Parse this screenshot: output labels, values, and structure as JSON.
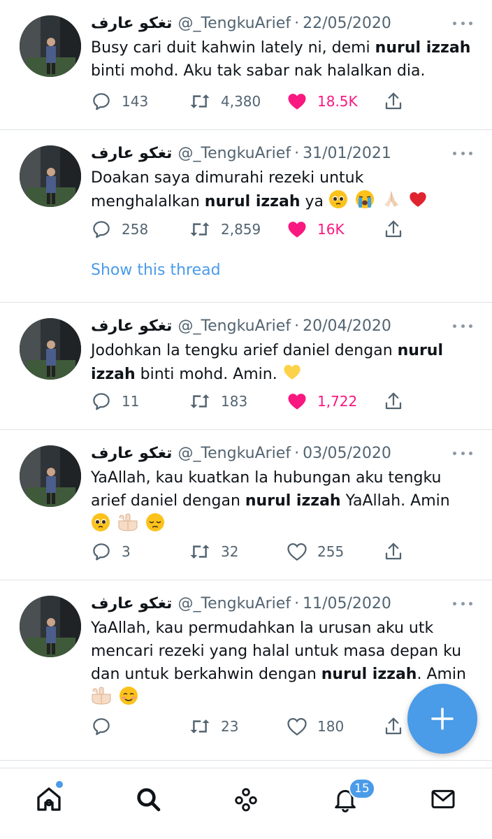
{
  "author": {
    "name": "تغكو عارف",
    "handle": "@_TengkuArief",
    "separator": "·"
  },
  "tweets": [
    {
      "date": "22/05/2020",
      "lines": [
        "Busy cari duit kahwin lately ni, demi ",
        "nurul izzah",
        "binti mohd. Aku tak sabar nak halalkan dia."
      ],
      "replies": "143",
      "retweets": "4,380",
      "likes": "18.5K",
      "liked": true
    },
    {
      "date": "31/01/2021",
      "lines": [
        "Doakan saya dimurahi rezeki untuk",
        "menghalalkan ",
        "nurul izzah",
        " ya"
      ],
      "emojis": [
        "pleading-face",
        "loudly-crying-face",
        "folded-hands",
        "red-heart"
      ],
      "replies": "258",
      "retweets": "2,859",
      "likes": "16K",
      "liked": true,
      "show_thread": "Show this thread"
    },
    {
      "date": "20/04/2020",
      "lines": [
        "Jodohkan la tengku arief daniel dengan ",
        "nurul",
        "izzah",
        " binti mohd. Amin."
      ],
      "emojis": [
        "yellow-heart"
      ],
      "replies": "11",
      "retweets": "183",
      "likes": "1,722",
      "liked": true
    },
    {
      "date": "03/05/2020",
      "lines": [
        "YaAllah, kau kuatkan la hubungan aku tengku",
        "arief daniel dengan ",
        "nurul izzah",
        " YaAllah. Amin"
      ],
      "emojis": [
        "pleading-face",
        "palms-up",
        "pensive-face"
      ],
      "replies": "3",
      "retweets": "32",
      "likes": "255",
      "liked": false
    },
    {
      "date": "11/05/2020",
      "lines": [
        "YaAllah, kau permudahkan la urusan aku utk",
        "mencari rezeki yang halal untuk masa depan ku",
        "dan untuk berkahwin dengan ",
        "nurul izzah",
        ". Amin"
      ],
      "emojis": [
        "palms-up",
        "smiling-face"
      ],
      "replies": "",
      "retweets": "23",
      "likes": "180",
      "liked": false
    }
  ],
  "nav": {
    "items": [
      "home-icon",
      "search-icon",
      "spaces-icon",
      "notifications-icon",
      "messages-icon"
    ],
    "notification_count": "15"
  },
  "colors": {
    "accent": "#4a9be8",
    "like": "#f91880",
    "muted": "#536471"
  }
}
